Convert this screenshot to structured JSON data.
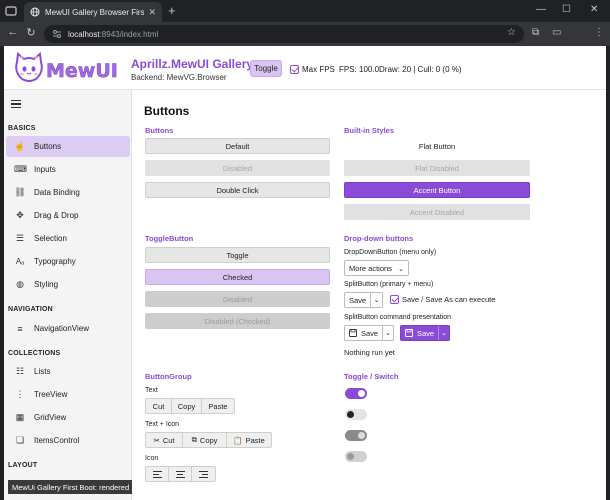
{
  "browser": {
    "tab_title": "MewUI Gallery Browser First Boot",
    "url_host": "localhost",
    "url_path": ":8943/index.html"
  },
  "header": {
    "logo_text": "MewUI",
    "app_title": "Aprillz.MewUI Gallery",
    "backend": "Backend: MewVG.Browser",
    "toggle_label": "Toggle",
    "maxfps_label": "Max FPS",
    "maxfps_checked": true,
    "fps": "FPS: 100.0",
    "draw": "Draw: 20 | Cull: 0 (0 %)"
  },
  "sidebar": {
    "sections": {
      "basics": "BASICS",
      "navigation": "NAVIGATION",
      "collections": "COLLECTIONS",
      "layout": "LAYOUT"
    },
    "basics": [
      {
        "label": "Buttons",
        "icon": "hand-pointer-icon",
        "active": true
      },
      {
        "label": "Inputs",
        "icon": "keyboard-icon"
      },
      {
        "label": "Data Binding",
        "icon": "link-icon"
      },
      {
        "label": "Drag & Drop",
        "icon": "move-icon"
      },
      {
        "label": "Selection",
        "icon": "checklist-icon"
      },
      {
        "label": "Typography",
        "icon": "text-icon"
      },
      {
        "label": "Styling",
        "icon": "palette-icon"
      }
    ],
    "navigation": [
      {
        "label": "NavigationView",
        "icon": "menu-icon"
      }
    ],
    "collections": [
      {
        "label": "Lists",
        "icon": "list-icon"
      },
      {
        "label": "TreeView",
        "icon": "tree-icon"
      },
      {
        "label": "GridView",
        "icon": "grid-icon"
      },
      {
        "label": "ItemsControl",
        "icon": "items-icon"
      }
    ],
    "status": "MewUi Gallery First Boot: rendered"
  },
  "content": {
    "page_title": "Buttons",
    "buttons": {
      "title": "Buttons",
      "default": "Default",
      "disabled": "Disabled",
      "double_click": "Double Click"
    },
    "builtin": {
      "title": "Built-in Styles",
      "flat": "Flat Button",
      "flat_disabled": "Flat Disabled",
      "accent": "Accent Button",
      "accent_disabled": "Accent Disabled"
    },
    "toggle": {
      "title": "ToggleButton",
      "toggle": "Toggle",
      "checked": "Checked",
      "disabled": "Disabled",
      "disabled_checked": "Disabled (Checked)"
    },
    "dropdown": {
      "title": "Drop-down buttons",
      "dd_label": "DropDownButton (menu only)",
      "more_actions": "More actions",
      "split_label": "SplitButton (primary + menu)",
      "save": "Save",
      "save_as_label": "Save / Save As can execute",
      "save_as_checked": true,
      "cmd_label": "SplitButton command presentation",
      "save_icon_1": "Save",
      "save_icon_2": "Save",
      "nothing_run": "Nothing run yet"
    },
    "group": {
      "title": "ButtonGroup",
      "text_label": "Text",
      "cut": "Cut",
      "copy": "Copy",
      "paste": "Paste",
      "text_icon_label": "Text + Icon",
      "cut2": "Cut",
      "copy2": "Copy",
      "paste2": "Paste",
      "icon_label": "Icon"
    },
    "switch": {
      "title": "Toggle / Switch",
      "states": [
        "on",
        "off",
        "on-disabled",
        "off-disabled"
      ]
    }
  },
  "colors": {
    "accent": "#8a4bd6",
    "checked_bg": "#d9c4f2",
    "sidebar_active": "#dccbf3"
  }
}
